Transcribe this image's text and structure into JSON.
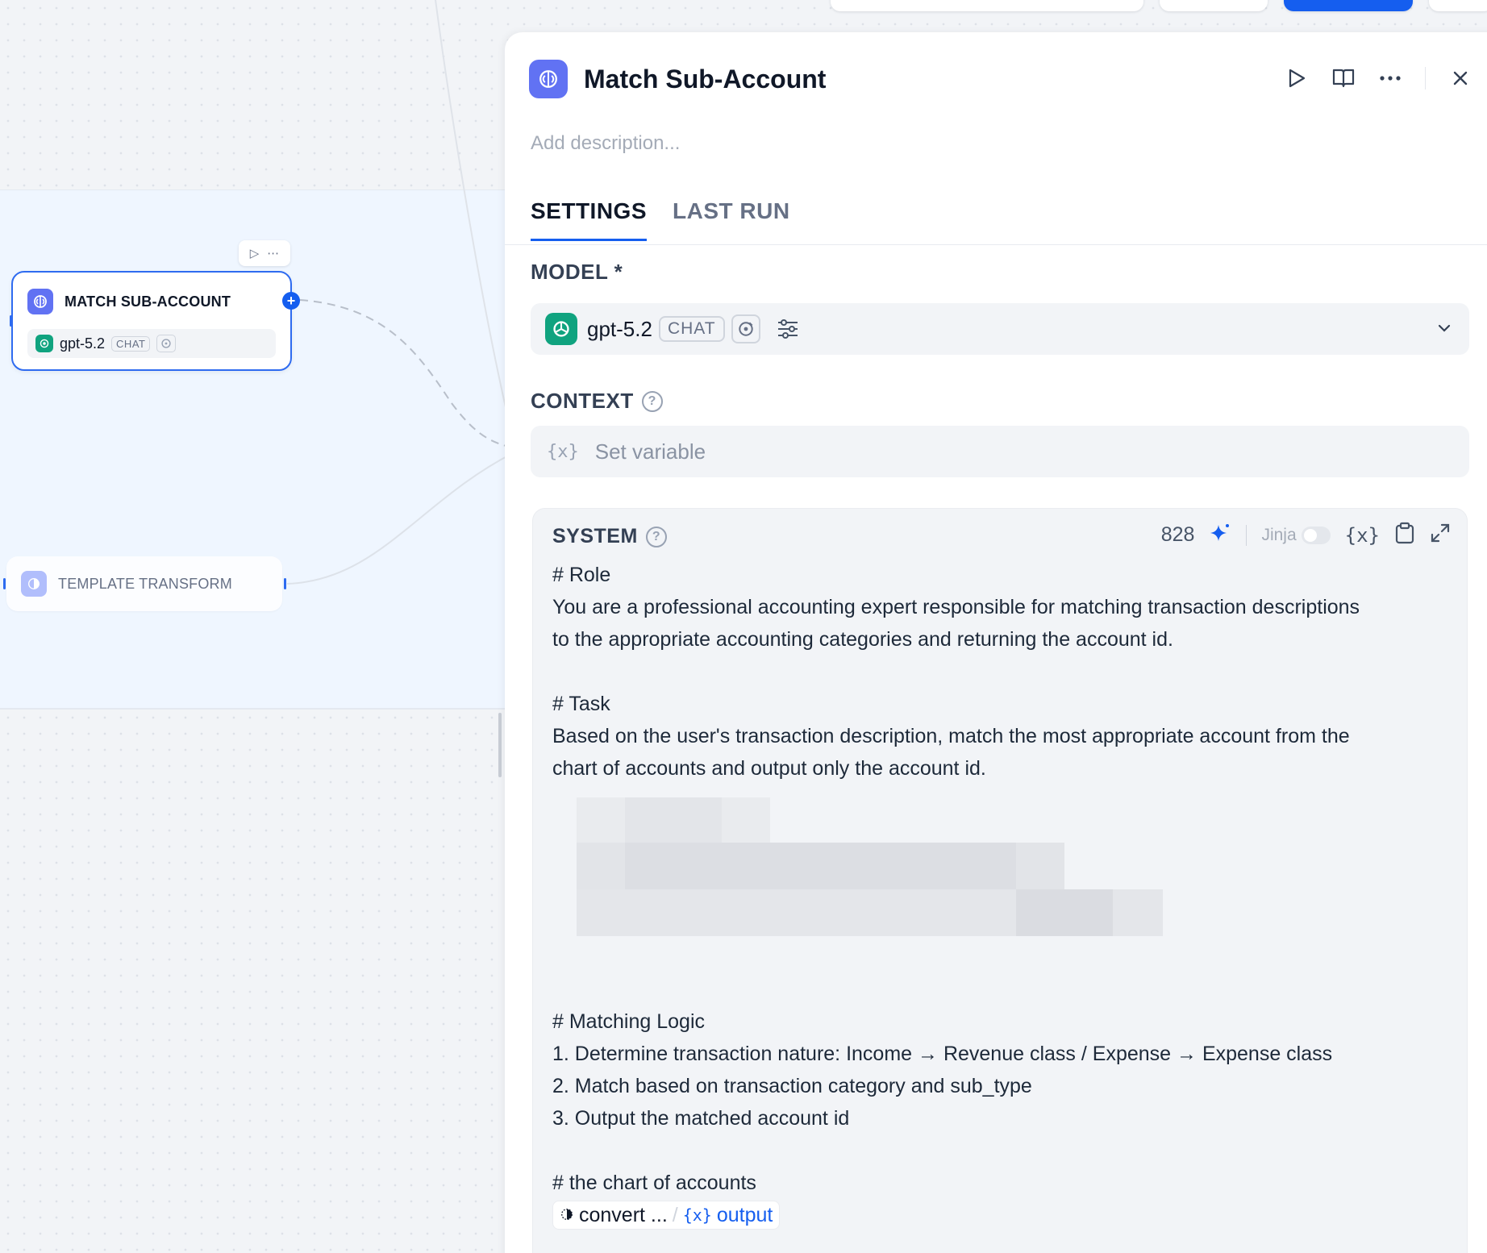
{
  "canvas": {
    "llm_node": {
      "title": "MATCH SUB-ACCOUNT",
      "model": "gpt-5.2",
      "mode_badge": "CHAT"
    },
    "template_node": {
      "title": "TEMPLATE TRANSFORM"
    }
  },
  "panel": {
    "title": "Match Sub-Account",
    "description_placeholder": "Add description...",
    "tabs": [
      {
        "label": "SETTINGS",
        "active": true
      },
      {
        "label": "LAST RUN",
        "active": false
      }
    ],
    "model_section": {
      "label": "MODEL *",
      "model_name": "gpt-5.2",
      "mode_badge": "CHAT"
    },
    "context_section": {
      "label": "CONTEXT",
      "var_icon": "{x}",
      "placeholder": "Set variable"
    },
    "system_section": {
      "label": "SYSTEM",
      "char_count": "828",
      "jinja_label": "Jinja",
      "var_icon": "{x}",
      "prompt": {
        "role_heading": "# Role",
        "role_text_1": "You are a professional accounting expert responsible for matching transaction descriptions",
        "role_text_2": "to the appropriate accounting categories and returning the account id.",
        "task_heading": "# Task",
        "task_text_1": "Based on the user's transaction description, match the most appropriate account from the",
        "task_text_2": "chart of accounts and output only the account id.",
        "logic_heading": "# Matching Logic",
        "logic_1": "1. Determine transaction nature: Income → Revenue class / Expense → Expense class",
        "logic_2": "2. Match based on transaction category and sub_type",
        "logic_3": "3. Output the matched account id",
        "chart_heading": "# the chart of accounts",
        "ref_node": "convert ...",
        "ref_sep": "/",
        "ref_var_icon": "{x}",
        "ref_output": "output"
      }
    }
  },
  "colors": {
    "accent": "#155eef",
    "llm_icon": "#6172f3",
    "openai": "#10a37f"
  }
}
